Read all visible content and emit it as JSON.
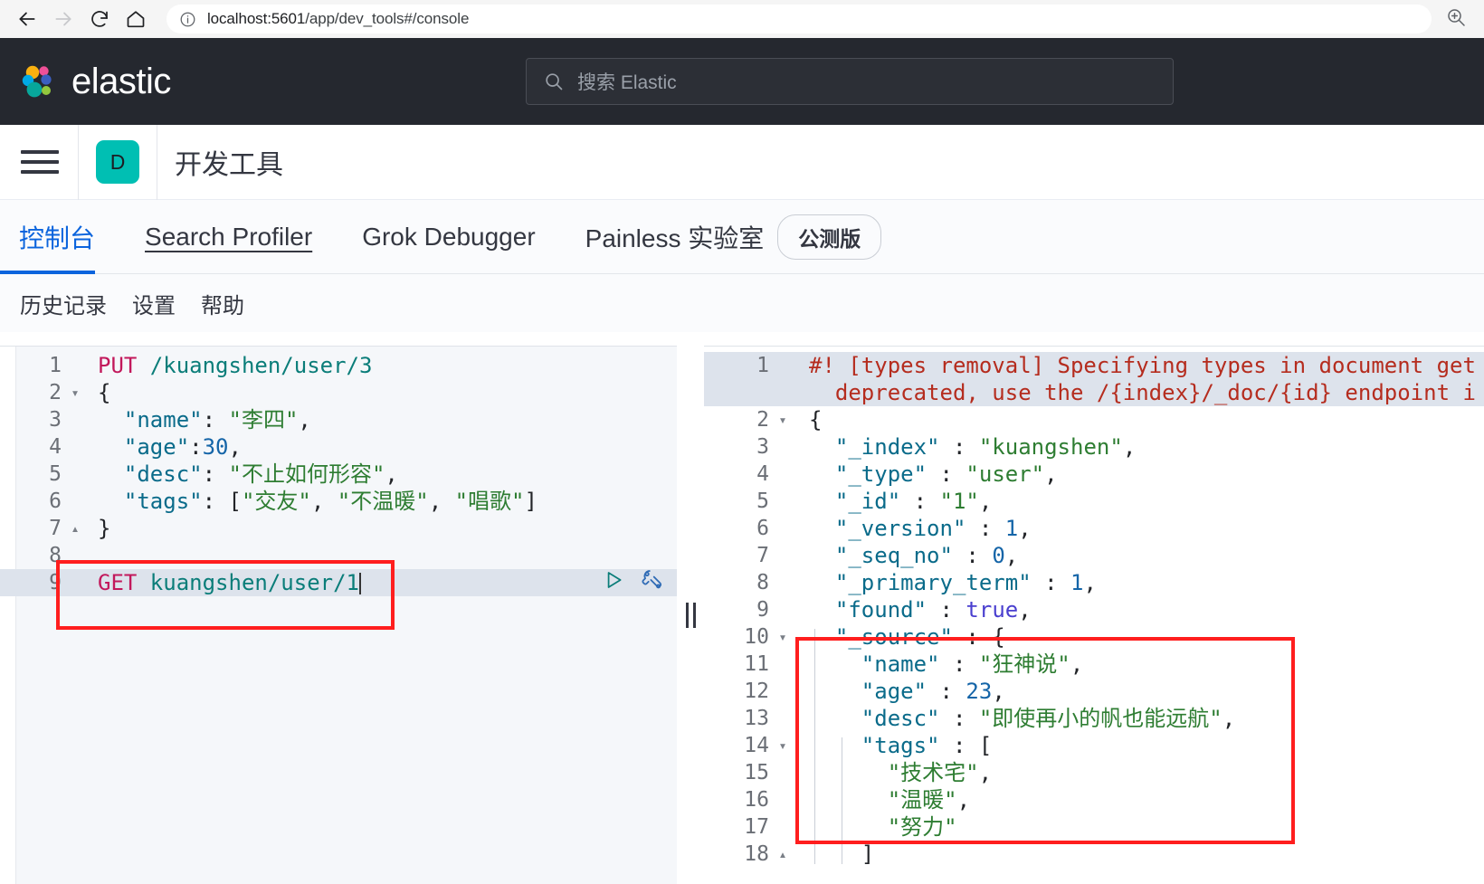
{
  "browser": {
    "back_icon": "arrow-left-icon",
    "forward_icon": "arrow-right-icon",
    "reload_icon": "reload-icon",
    "home_icon": "home-icon",
    "info_icon": "site-info-icon",
    "url_host": "localhost:5601",
    "url_path": "/app/dev_tools#/console",
    "zoom_icon": "zoom-in-icon"
  },
  "header": {
    "brand": "elastic",
    "brand_logo_icon": "elastic-logo-icon",
    "search_icon": "search-icon",
    "search_placeholder": "搜索 Elastic",
    "background": "#25282f"
  },
  "appbar": {
    "menu_icon": "hamburger-menu-icon",
    "badge_letter": "D",
    "badge_color": "#00bfb3",
    "title": "开发工具"
  },
  "tabs": {
    "accent": "#0b64dd",
    "items": [
      {
        "label": "控制台",
        "active": true,
        "underlined": false
      },
      {
        "label": "Search Profiler",
        "active": false,
        "underlined": true
      },
      {
        "label": "Grok Debugger",
        "active": false,
        "underlined": false
      },
      {
        "label": "Painless 实验室",
        "active": false,
        "underlined": false
      }
    ],
    "badge": "公测版"
  },
  "subnav": {
    "items": [
      {
        "label": "历史记录"
      },
      {
        "label": "设置"
      },
      {
        "label": "帮助"
      }
    ]
  },
  "editor": {
    "play_icon": "play-request-icon",
    "wrench_icon": "wrench-icon",
    "splitter_icon": "drag-handle-icon",
    "lines": [
      {
        "n": "1",
        "fold": "",
        "highlight": false,
        "parts": [
          {
            "t": "PUT ",
            "c": "t-method"
          },
          {
            "t": "/kuangshen/user/3",
            "c": "t-url"
          }
        ]
      },
      {
        "n": "2",
        "fold": "▾",
        "highlight": false,
        "parts": [
          {
            "t": "{",
            "c": "t-punct"
          }
        ]
      },
      {
        "n": "3",
        "fold": "",
        "highlight": false,
        "parts": [
          {
            "t": "  ",
            "c": "t-punct"
          },
          {
            "t": "\"name\"",
            "c": "t-key"
          },
          {
            "t": ": ",
            "c": "t-punct"
          },
          {
            "t": "\"李四\"",
            "c": "t-str"
          },
          {
            "t": ",",
            "c": "t-punct"
          }
        ]
      },
      {
        "n": "4",
        "fold": "",
        "highlight": false,
        "parts": [
          {
            "t": "  ",
            "c": "t-punct"
          },
          {
            "t": "\"age\"",
            "c": "t-key"
          },
          {
            "t": ":",
            "c": "t-punct"
          },
          {
            "t": "30",
            "c": "t-num"
          },
          {
            "t": ",",
            "c": "t-punct"
          }
        ]
      },
      {
        "n": "5",
        "fold": "",
        "highlight": false,
        "parts": [
          {
            "t": "  ",
            "c": "t-punct"
          },
          {
            "t": "\"desc\"",
            "c": "t-key"
          },
          {
            "t": ": ",
            "c": "t-punct"
          },
          {
            "t": "\"不止如何形容\"",
            "c": "t-str"
          },
          {
            "t": ",",
            "c": "t-punct"
          }
        ]
      },
      {
        "n": "6",
        "fold": "",
        "highlight": false,
        "parts": [
          {
            "t": "  ",
            "c": "t-punct"
          },
          {
            "t": "\"tags\"",
            "c": "t-key"
          },
          {
            "t": ": [",
            "c": "t-punct"
          },
          {
            "t": "\"交友\"",
            "c": "t-str"
          },
          {
            "t": ", ",
            "c": "t-punct"
          },
          {
            "t": "\"不温暖\"",
            "c": "t-str"
          },
          {
            "t": ", ",
            "c": "t-punct"
          },
          {
            "t": "\"唱歌\"",
            "c": "t-str"
          },
          {
            "t": "]",
            "c": "t-punct"
          }
        ]
      },
      {
        "n": "7",
        "fold": "▴",
        "highlight": false,
        "parts": [
          {
            "t": "}",
            "c": "t-punct"
          }
        ]
      },
      {
        "n": "8",
        "fold": "",
        "highlight": false,
        "parts": []
      },
      {
        "n": "9",
        "fold": "",
        "highlight": true,
        "actions": true,
        "parts": [
          {
            "t": "GET ",
            "c": "t-method"
          },
          {
            "t": "kuangshen/user/1",
            "c": "t-url"
          },
          {
            "t": "CARET",
            "c": "caret"
          }
        ]
      }
    ]
  },
  "response": {
    "lines": [
      {
        "n": "1",
        "fold": "",
        "highlight": true,
        "parts": [
          {
            "t": "#! [types removal] Specifying types in document get",
            "c": "t-warn"
          }
        ]
      },
      {
        "n": "",
        "fold": "",
        "highlight": true,
        "parts": [
          {
            "t": "  deprecated, use the /{index}/_doc/{id} endpoint i",
            "c": "t-warn"
          }
        ]
      },
      {
        "n": "2",
        "fold": "▾",
        "highlight": false,
        "parts": [
          {
            "t": "{",
            "c": "t-punct"
          }
        ]
      },
      {
        "n": "3",
        "fold": "",
        "highlight": false,
        "parts": [
          {
            "t": "  ",
            "c": "t-punct"
          },
          {
            "t": "\"_index\"",
            "c": "t-key"
          },
          {
            "t": " : ",
            "c": "t-punct"
          },
          {
            "t": "\"kuangshen\"",
            "c": "t-str"
          },
          {
            "t": ",",
            "c": "t-punct"
          }
        ]
      },
      {
        "n": "4",
        "fold": "",
        "highlight": false,
        "parts": [
          {
            "t": "  ",
            "c": "t-punct"
          },
          {
            "t": "\"_type\"",
            "c": "t-key"
          },
          {
            "t": " : ",
            "c": "t-punct"
          },
          {
            "t": "\"user\"",
            "c": "t-str"
          },
          {
            "t": ",",
            "c": "t-punct"
          }
        ]
      },
      {
        "n": "5",
        "fold": "",
        "highlight": false,
        "parts": [
          {
            "t": "  ",
            "c": "t-punct"
          },
          {
            "t": "\"_id\"",
            "c": "t-key"
          },
          {
            "t": " : ",
            "c": "t-punct"
          },
          {
            "t": "\"1\"",
            "c": "t-str"
          },
          {
            "t": ",",
            "c": "t-punct"
          }
        ]
      },
      {
        "n": "6",
        "fold": "",
        "highlight": false,
        "parts": [
          {
            "t": "  ",
            "c": "t-punct"
          },
          {
            "t": "\"_version\"",
            "c": "t-key"
          },
          {
            "t": " : ",
            "c": "t-punct"
          },
          {
            "t": "1",
            "c": "t-num"
          },
          {
            "t": ",",
            "c": "t-punct"
          }
        ]
      },
      {
        "n": "7",
        "fold": "",
        "highlight": false,
        "parts": [
          {
            "t": "  ",
            "c": "t-punct"
          },
          {
            "t": "\"_seq_no\"",
            "c": "t-key"
          },
          {
            "t": " : ",
            "c": "t-punct"
          },
          {
            "t": "0",
            "c": "t-num"
          },
          {
            "t": ",",
            "c": "t-punct"
          }
        ]
      },
      {
        "n": "8",
        "fold": "",
        "highlight": false,
        "parts": [
          {
            "t": "  ",
            "c": "t-punct"
          },
          {
            "t": "\"_primary_term\"",
            "c": "t-key"
          },
          {
            "t": " : ",
            "c": "t-punct"
          },
          {
            "t": "1",
            "c": "t-num"
          },
          {
            "t": ",",
            "c": "t-punct"
          }
        ]
      },
      {
        "n": "9",
        "fold": "",
        "highlight": false,
        "parts": [
          {
            "t": "  ",
            "c": "t-punct"
          },
          {
            "t": "\"found\"",
            "c": "t-key"
          },
          {
            "t": " : ",
            "c": "t-punct"
          },
          {
            "t": "true",
            "c": "t-bool"
          },
          {
            "t": ",",
            "c": "t-punct"
          }
        ]
      },
      {
        "n": "10",
        "fold": "▾",
        "highlight": false,
        "parts": [
          {
            "t": "  ",
            "c": "t-punct"
          },
          {
            "t": "\"_source\"",
            "c": "t-key"
          },
          {
            "t": " : {",
            "c": "t-punct"
          }
        ]
      },
      {
        "n": "11",
        "fold": "",
        "highlight": false,
        "parts": [
          {
            "t": "    ",
            "c": "t-punct"
          },
          {
            "t": "\"name\"",
            "c": "t-key"
          },
          {
            "t": " : ",
            "c": "t-punct"
          },
          {
            "t": "\"狂神说\"",
            "c": "t-str"
          },
          {
            "t": ",",
            "c": "t-punct"
          }
        ]
      },
      {
        "n": "12",
        "fold": "",
        "highlight": false,
        "parts": [
          {
            "t": "    ",
            "c": "t-punct"
          },
          {
            "t": "\"age\"",
            "c": "t-key"
          },
          {
            "t": " : ",
            "c": "t-punct"
          },
          {
            "t": "23",
            "c": "t-num"
          },
          {
            "t": ",",
            "c": "t-punct"
          }
        ]
      },
      {
        "n": "13",
        "fold": "",
        "highlight": false,
        "parts": [
          {
            "t": "    ",
            "c": "t-punct"
          },
          {
            "t": "\"desc\"",
            "c": "t-key"
          },
          {
            "t": " : ",
            "c": "t-punct"
          },
          {
            "t": "\"即使再小的帆也能远航\"",
            "c": "t-str"
          },
          {
            "t": ",",
            "c": "t-punct"
          }
        ]
      },
      {
        "n": "14",
        "fold": "▾",
        "highlight": false,
        "parts": [
          {
            "t": "    ",
            "c": "t-punct"
          },
          {
            "t": "\"tags\"",
            "c": "t-key"
          },
          {
            "t": " : [",
            "c": "t-punct"
          }
        ]
      },
      {
        "n": "15",
        "fold": "",
        "highlight": false,
        "parts": [
          {
            "t": "      ",
            "c": "t-punct"
          },
          {
            "t": "\"技术宅\"",
            "c": "t-str"
          },
          {
            "t": ",",
            "c": "t-punct"
          }
        ]
      },
      {
        "n": "16",
        "fold": "",
        "highlight": false,
        "parts": [
          {
            "t": "      ",
            "c": "t-punct"
          },
          {
            "t": "\"温暖\"",
            "c": "t-str"
          },
          {
            "t": ",",
            "c": "t-punct"
          }
        ]
      },
      {
        "n": "17",
        "fold": "",
        "highlight": false,
        "parts": [
          {
            "t": "      ",
            "c": "t-punct"
          },
          {
            "t": "\"努力\"",
            "c": "t-str"
          }
        ]
      },
      {
        "n": "18",
        "fold": "▴",
        "highlight": false,
        "parts": [
          {
            "t": "    ",
            "c": "t-punct"
          },
          {
            "t": "]",
            "c": "t-punct"
          }
        ]
      }
    ]
  },
  "annotations": {
    "left_box_color": "#ff1e1e",
    "right_box_color": "#ff1e1e"
  }
}
